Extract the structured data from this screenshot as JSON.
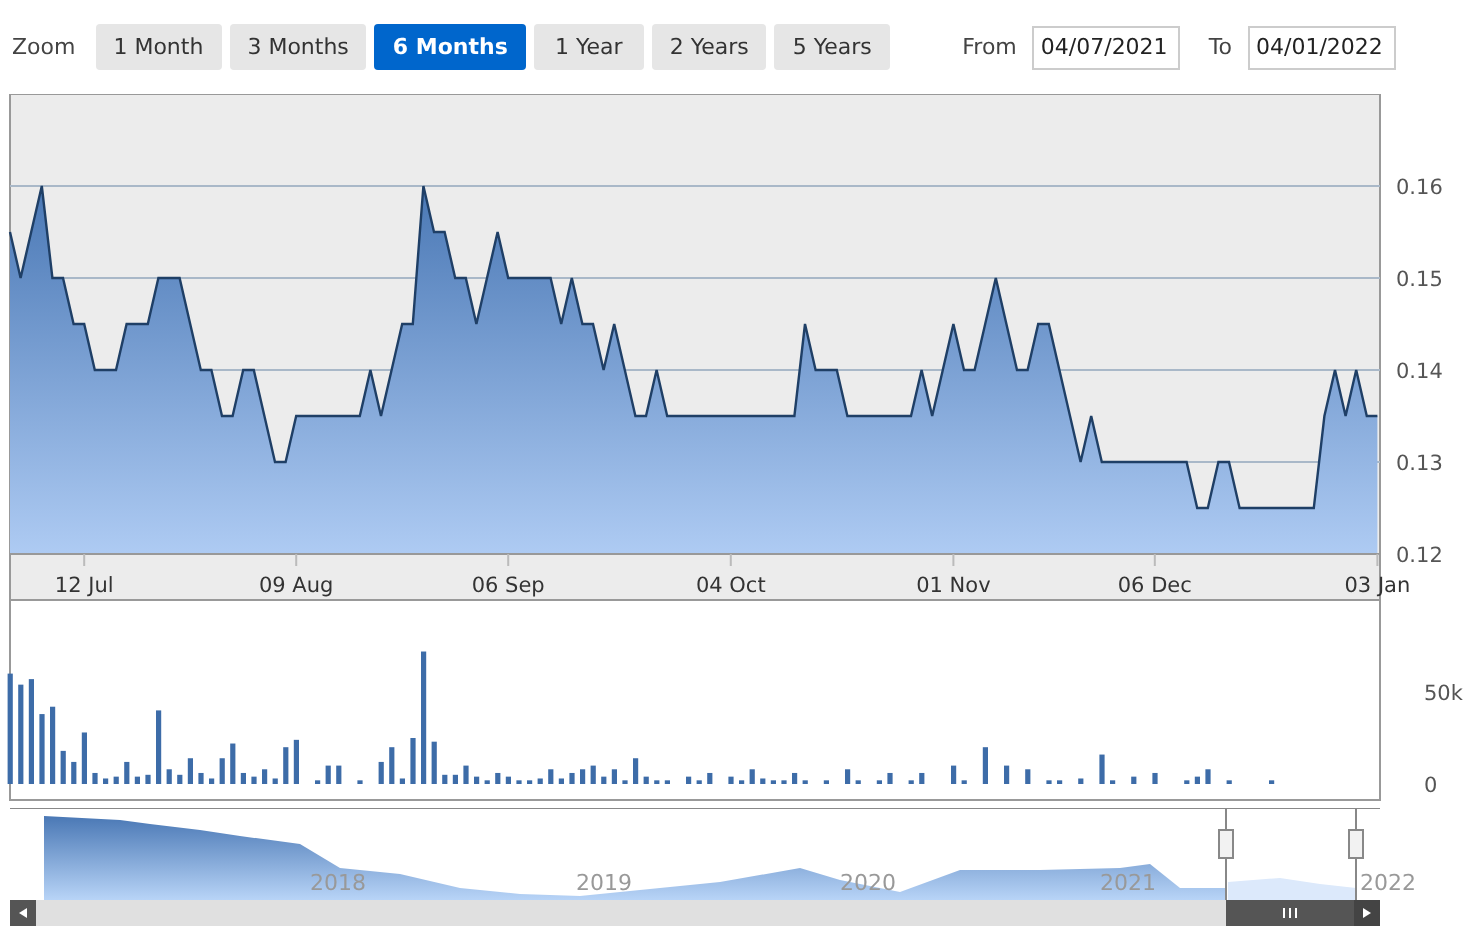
{
  "zoom": {
    "label": "Zoom",
    "buttons": [
      {
        "label": "1 Month",
        "selected": false
      },
      {
        "label": "3 Months",
        "selected": false
      },
      {
        "label": "6 Months",
        "selected": true
      },
      {
        "label": "1 Year",
        "selected": false
      },
      {
        "label": "2 Years",
        "selected": false
      },
      {
        "label": "5 Years",
        "selected": false
      }
    ]
  },
  "range": {
    "from_label": "From",
    "from": "04/07/2021",
    "to_label": "To",
    "to": "04/01/2022"
  },
  "price_chart": {
    "chart_data": {
      "type": "area",
      "grid": true,
      "ylim": [
        0.12,
        0.17
      ],
      "yticks": [
        {
          "value": 0.12,
          "label": "0.12"
        },
        {
          "value": 0.13,
          "label": "0.13"
        },
        {
          "value": 0.14,
          "label": "0.14"
        },
        {
          "value": 0.15,
          "label": "0.15"
        },
        {
          "value": 0.16,
          "label": "0.16"
        }
      ],
      "categories": [
        null,
        null,
        null,
        null,
        null,
        null,
        null,
        "12 Jul",
        null,
        null,
        null,
        null,
        null,
        null,
        null,
        null,
        null,
        null,
        null,
        null,
        null,
        null,
        null,
        null,
        null,
        null,
        null,
        "09 Aug",
        null,
        null,
        null,
        null,
        null,
        null,
        null,
        null,
        null,
        null,
        null,
        null,
        null,
        null,
        null,
        null,
        null,
        null,
        null,
        "06 Sep",
        null,
        null,
        null,
        null,
        null,
        null,
        null,
        null,
        null,
        null,
        null,
        null,
        null,
        null,
        null,
        null,
        null,
        null,
        null,
        null,
        "04 Oct",
        null,
        null,
        null,
        null,
        null,
        null,
        null,
        null,
        null,
        null,
        null,
        null,
        null,
        null,
        null,
        null,
        null,
        null,
        null,
        null,
        "01 Nov",
        null,
        null,
        null,
        null,
        null,
        null,
        null,
        null,
        null,
        null,
        null,
        null,
        null,
        null,
        null,
        null,
        null,
        null,
        "06 Dec",
        null,
        null,
        null,
        null,
        null,
        null,
        null,
        null,
        null,
        null,
        null,
        null,
        null,
        null,
        null,
        null,
        null,
        null,
        null,
        null,
        "03 Jan"
      ],
      "series": [
        {
          "color": "#1f3f66",
          "values": [
            0.155,
            0.15,
            0.155,
            0.16,
            0.15,
            0.15,
            0.145,
            0.145,
            0.14,
            0.14,
            0.14,
            0.145,
            0.145,
            0.145,
            0.15,
            0.15,
            0.15,
            0.145,
            0.14,
            0.14,
            0.135,
            0.135,
            0.14,
            0.14,
            0.135,
            0.13,
            0.13,
            0.135,
            0.135,
            0.135,
            0.135,
            0.135,
            0.135,
            0.135,
            0.14,
            0.135,
            0.14,
            0.145,
            0.145,
            0.16,
            0.155,
            0.155,
            0.15,
            0.15,
            0.145,
            0.15,
            0.155,
            0.15,
            0.15,
            0.15,
            0.15,
            0.15,
            0.145,
            0.15,
            0.145,
            0.145,
            0.14,
            0.145,
            0.14,
            0.135,
            0.135,
            0.14,
            0.135,
            0.135,
            0.135,
            0.135,
            0.135,
            0.135,
            0.135,
            0.135,
            0.135,
            0.135,
            0.135,
            0.135,
            0.135,
            0.145,
            0.14,
            0.14,
            0.14,
            0.135,
            0.135,
            0.135,
            0.135,
            0.135,
            0.135,
            0.135,
            0.14,
            0.135,
            0.14,
            0.145,
            0.14,
            0.14,
            0.145,
            0.15,
            0.145,
            0.14,
            0.14,
            0.145,
            0.145,
            0.14,
            0.135,
            0.13,
            0.135,
            0.13,
            0.13,
            0.13,
            0.13,
            0.13,
            0.13,
            0.13,
            0.13,
            0.13,
            0.125,
            0.125,
            0.13,
            0.13,
            0.125,
            0.125,
            0.125,
            0.125,
            0.125,
            0.125,
            0.125,
            0.125,
            0.135,
            0.14,
            0.135,
            0.14,
            0.135,
            0.135
          ]
        }
      ]
    }
  },
  "volume_chart": {
    "chart_data": {
      "type": "bar",
      "ylim": [
        0,
        100000
      ],
      "yticks": [
        {
          "value": 0,
          "label": "0"
        },
        {
          "value": 50000,
          "label": "50k"
        }
      ],
      "categories": [
        null,
        null,
        null,
        null,
        null,
        null,
        null,
        null,
        null,
        null,
        null,
        null,
        null,
        null,
        null,
        null,
        null,
        null,
        null,
        null,
        null,
        null,
        null,
        null,
        null,
        null,
        null,
        null,
        null,
        null,
        null,
        null,
        null,
        null,
        null,
        null,
        null,
        null,
        null,
        null,
        null,
        null,
        null,
        null,
        null,
        null,
        null,
        null,
        null,
        null,
        null,
        null,
        null,
        null,
        null,
        null,
        null,
        null,
        null,
        null,
        null,
        null,
        null,
        null,
        null,
        null,
        null,
        null,
        null,
        null,
        null,
        null,
        null,
        null,
        null,
        null,
        null,
        null,
        null,
        null,
        null,
        null,
        null,
        null,
        null,
        null,
        null,
        null,
        null,
        null,
        null,
        null,
        null,
        null,
        null,
        null,
        null,
        null,
        null,
        null,
        null,
        null,
        null,
        null,
        null,
        null,
        null,
        null,
        null,
        null,
        null,
        null,
        null,
        null,
        null,
        null,
        null,
        null,
        null,
        null,
        null,
        null,
        null,
        null,
        null,
        null,
        null,
        null,
        null,
        null
      ],
      "series": [
        {
          "color": "#3d6ca8",
          "values": [
            60000,
            54000,
            57000,
            38000,
            42000,
            18000,
            12000,
            28000,
            6000,
            3000,
            4000,
            12000,
            4000,
            5000,
            40000,
            8000,
            5000,
            14000,
            6000,
            3000,
            14000,
            22000,
            6000,
            4000,
            8000,
            3000,
            20000,
            24000,
            null,
            2000,
            10000,
            10000,
            null,
            2000,
            null,
            12000,
            20000,
            3000,
            25000,
            72000,
            23000,
            5000,
            5000,
            10000,
            4000,
            2000,
            6000,
            4000,
            2000,
            2000,
            3000,
            8000,
            3000,
            6000,
            8000,
            10000,
            4000,
            8000,
            2000,
            14000,
            4000,
            2000,
            2000,
            null,
            4000,
            2000,
            6000,
            null,
            4000,
            2000,
            8000,
            3000,
            2000,
            2000,
            6000,
            2000,
            null,
            2000,
            null,
            8000,
            2000,
            null,
            2000,
            6000,
            null,
            2000,
            6000,
            null,
            null,
            10000,
            2000,
            null,
            20000,
            null,
            10000,
            null,
            8000,
            null,
            2000,
            2000,
            null,
            3000,
            null,
            16000,
            2000,
            null,
            4000,
            null,
            6000,
            null,
            null,
            2000,
            4000,
            8000,
            null,
            2000,
            null,
            null,
            null,
            2000,
            null,
            null,
            null,
            null,
            null,
            null,
            null,
            null,
            null,
            null
          ]
        }
      ]
    }
  },
  "navigator": {
    "years": [
      "2018",
      "2019",
      "2020",
      "2021",
      "2022"
    ]
  }
}
